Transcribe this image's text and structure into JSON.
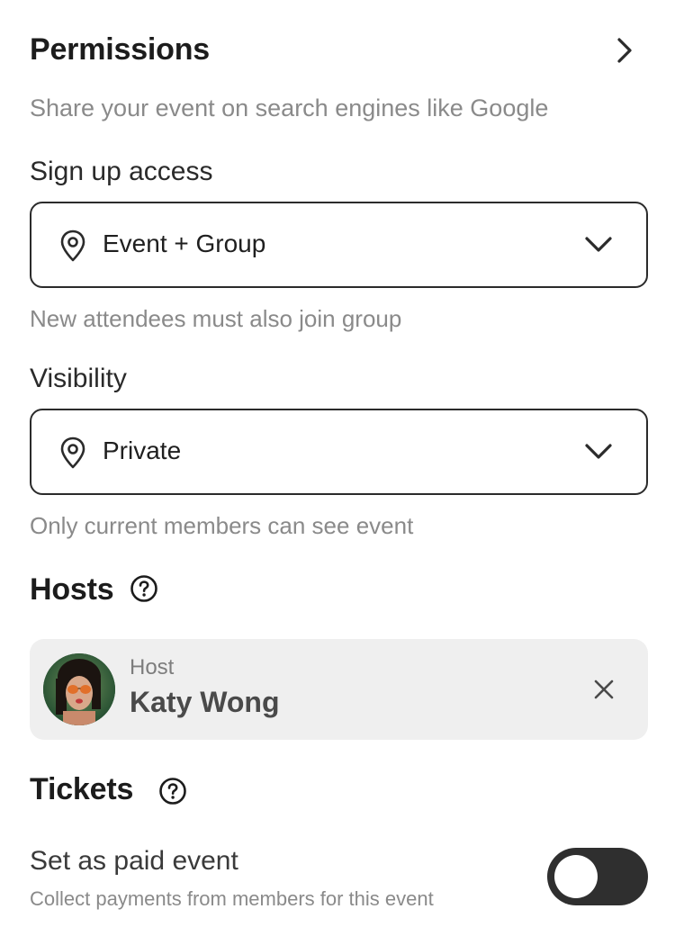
{
  "permissions": {
    "title": "Permissions",
    "description": "Share your event on search engines like Google"
  },
  "signup_access": {
    "label": "Sign up access",
    "value": "Event + Group",
    "helper": "New attendees must also join group"
  },
  "visibility": {
    "label": "Visibility",
    "value": "Private",
    "helper": "Only current members can see event"
  },
  "hosts": {
    "title": "Hosts",
    "items": [
      {
        "role": "Host",
        "name": "Katy Wong"
      }
    ]
  },
  "tickets": {
    "title": "Tickets",
    "paid_event": {
      "label": "Set as paid event",
      "description": "Collect payments from members for this event",
      "enabled": false
    }
  },
  "icons": {
    "permissions_arrow": "chevron-right-icon",
    "select_leading": "location-pin-icon",
    "select_trailing": "chevron-down-icon",
    "help": "question-circle-icon",
    "remove_host": "close-icon"
  },
  "colors": {
    "text_primary": "#1c1c1c",
    "text_secondary": "#8a8a8a",
    "border": "#2b2b2b",
    "card_bg": "#efefef",
    "toggle_off": "#2f2f2f"
  }
}
